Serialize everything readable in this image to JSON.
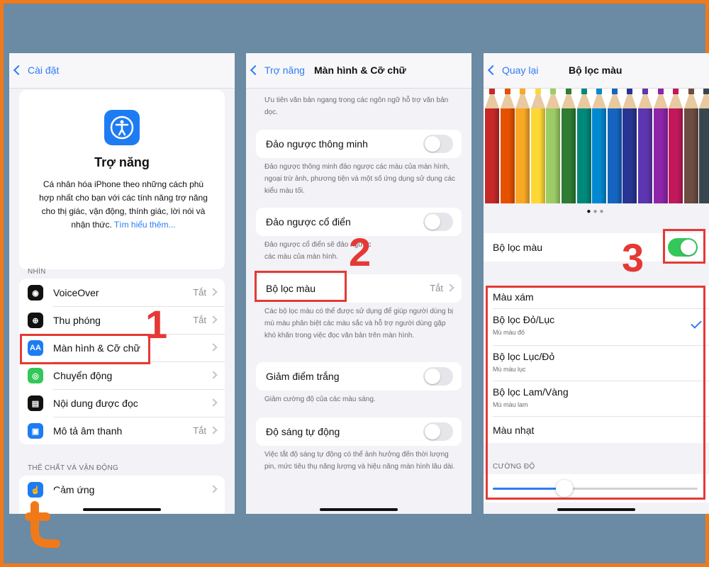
{
  "brand": {
    "accent": "#f07a1a",
    "background": "#6b8aa3",
    "highlight": "#e53935"
  },
  "screen1": {
    "back_label": "Cài đặt",
    "heading": "Trợ năng",
    "description": "Cá nhân hóa iPhone theo những cách phù hợp nhất cho bạn với các tính năng trợ năng cho thị giác, vận động, thính giác, lời nói và nhận thức.",
    "learn_more": "Tìm hiểu thêm...",
    "section_vision": "NHÌN",
    "items": [
      {
        "label": "VoiceOver",
        "value": "Tắt",
        "icon": "voiceover-icon"
      },
      {
        "label": "Thu phóng",
        "value": "Tắt",
        "icon": "zoom-icon"
      },
      {
        "label": "Màn hình & Cỡ chữ",
        "value": "",
        "icon": "text-size-icon"
      },
      {
        "label": "Chuyển động",
        "value": "",
        "icon": "motion-icon"
      },
      {
        "label": "Nội dung được đọc",
        "value": "",
        "icon": "spoken-content-icon"
      },
      {
        "label": "Mô tả âm thanh",
        "value": "Tắt",
        "icon": "audio-description-icon"
      }
    ],
    "section_physical": "THỂ CHẤT VÀ VẬN ĐỘNG",
    "touch_label": "Cảm ứng"
  },
  "screen2": {
    "back_label": "Trợ năng",
    "title": "Màn hình & Cỡ chữ",
    "top_note": "Ưu tiên văn bản ngang trong các ngôn ngữ hỗ trợ văn bản dọc.",
    "smart_invert": "Đảo ngược thông minh",
    "smart_invert_note": "Đảo ngược thông minh đảo ngược các màu của màn hình, ngoại trừ ảnh, phương tiện và một số ứng dụng sử dụng các kiểu màu tối.",
    "classic_invert": "Đảo ngược cổ điển",
    "classic_invert_note": "Đảo ngược cổ điển sẽ đảo ngược các màu của màn hình.",
    "color_filters": "Bộ lọc màu",
    "color_filters_value": "Tắt",
    "color_filters_note": "Các bộ lọc màu có thể được sử dụng để giúp người dùng bị mù màu phân biệt các màu sắc và hỗ trợ người dùng gặp khó khăn trong việc đọc văn bản trên màn hình.",
    "reduce_white": "Giảm điểm trắng",
    "reduce_white_note": "Giảm cường độ của các màu sáng.",
    "auto_brightness": "Độ sáng tự động",
    "auto_brightness_note": "Việc tắt độ sáng tự động có thể ảnh hưởng đến thời lượng pin, mức tiêu thụ năng lượng và hiệu năng màn hình lâu dài."
  },
  "screen3": {
    "back_label": "Quay lại",
    "title": "Bộ lọc màu",
    "pencil_colors": [
      "#c62828",
      "#e65100",
      "#f9a825",
      "#fdd835",
      "#9ccc65",
      "#2e7d32",
      "#00897b",
      "#0288d1",
      "#1565c0",
      "#283593",
      "#5e35b1",
      "#8e24aa",
      "#c2185b",
      "#6d4c41",
      "#37474f"
    ],
    "toggle_label": "Bộ lọc màu",
    "toggle_on": true,
    "filters": [
      {
        "label": "Màu xám",
        "sub": ""
      },
      {
        "label": "Bộ lọc Đỏ/Lục",
        "sub": "Mù màu đỏ",
        "selected": true
      },
      {
        "label": "Bộ lọc Lục/Đỏ",
        "sub": "Mù màu lục"
      },
      {
        "label": "Bộ lọc Lam/Vàng",
        "sub": "Mù màu lam"
      },
      {
        "label": "Màu nhạt",
        "sub": ""
      }
    ],
    "intensity_label": "CƯỜNG ĐỘ",
    "intensity_value": 0.35
  },
  "steps": [
    "1",
    "2",
    "3"
  ]
}
